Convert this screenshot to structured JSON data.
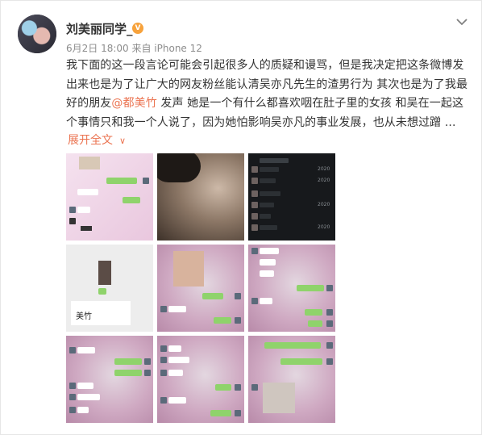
{
  "post": {
    "username": "刘美丽同学_",
    "verified_badge": "V",
    "timestamp": "6月2日 18:00 来自 iPhone 12",
    "body": "我下面的这一段言论可能会引起很多人的质疑和谩骂，但是我决定把这条微博发出来也是为了让广大的网友粉丝能认清吴亦凡先生的渣男行为 其次也是为了我最好的朋友",
    "mention": "@都美竹",
    "body_rest": " 发声 她是一个有什么都喜欢咽在肚子里的女孩 和吴在一起这个事情只和我一个人说了，因为她怕影响吴亦凡的事业发展，也从未想过蹭 ...",
    "expand_label": "展开全文",
    "expand_icon": "chevron-down-icon",
    "more_icon": "chevron-down-icon",
    "accent_color": "#eb7350"
  },
  "images": [
    {
      "id": 1,
      "style": "pink-chat"
    },
    {
      "id": 2,
      "style": "selfie"
    },
    {
      "id": 3,
      "style": "dark-chat-list"
    },
    {
      "id": 4,
      "style": "gray-chat",
      "big_text": "美竹"
    },
    {
      "id": 5,
      "style": "blush-chat-photo"
    },
    {
      "id": 6,
      "style": "blush-chat"
    },
    {
      "id": 7,
      "style": "blush-chat"
    },
    {
      "id": 8,
      "style": "blush-chat"
    },
    {
      "id": 9,
      "style": "blush-chat-photo"
    }
  ]
}
